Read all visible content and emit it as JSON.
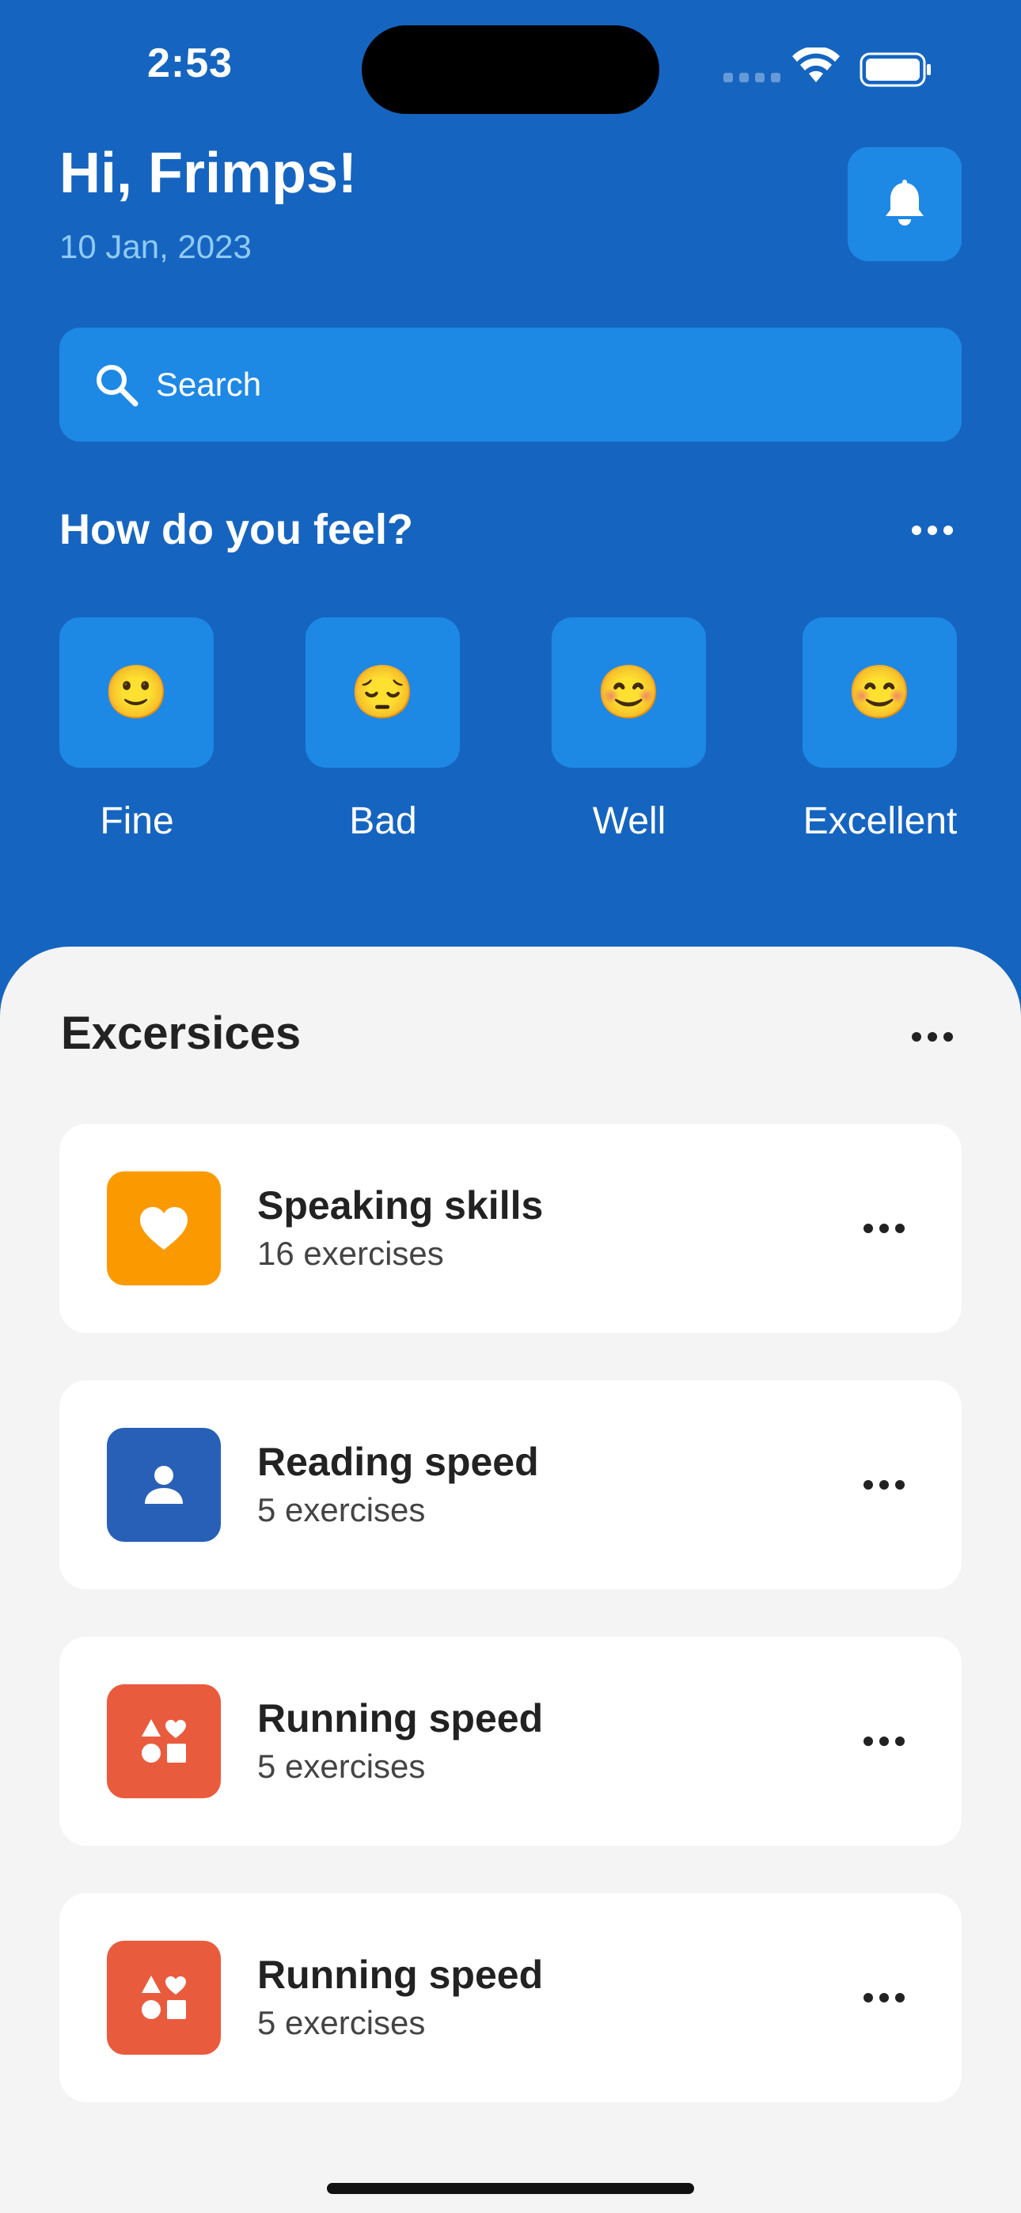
{
  "status_bar": {
    "time": "2:53"
  },
  "header": {
    "greeting": "Hi, Frimps!",
    "date": "10 Jan, 2023"
  },
  "search": {
    "placeholder": "Search"
  },
  "feelings": {
    "title": "How do you feel?",
    "moods": [
      {
        "emoji": "🙂",
        "label": "Fine"
      },
      {
        "emoji": "😔",
        "label": "Bad"
      },
      {
        "emoji": "😊",
        "label": "Well"
      },
      {
        "emoji": "😊",
        "label": "Excellent"
      }
    ]
  },
  "exercises": {
    "title": "Excersices",
    "items": [
      {
        "name": "Speaking skills",
        "count": "16 exercises",
        "icon": "heart-icon",
        "color": "#fb9a00"
      },
      {
        "name": "Reading speed",
        "count": "5 exercises",
        "icon": "person-icon",
        "color": "#2860b8"
      },
      {
        "name": "Running speed",
        "count": "5 exercises",
        "icon": "shapes-icon",
        "color": "#e95b3d"
      },
      {
        "name": "Running speed",
        "count": "5 exercises",
        "icon": "shapes-icon",
        "color": "#e95b3d"
      }
    ]
  },
  "colors": {
    "primary": "#1565c0",
    "tile": "#1e88e5",
    "sheet": "#f4f4f4"
  }
}
